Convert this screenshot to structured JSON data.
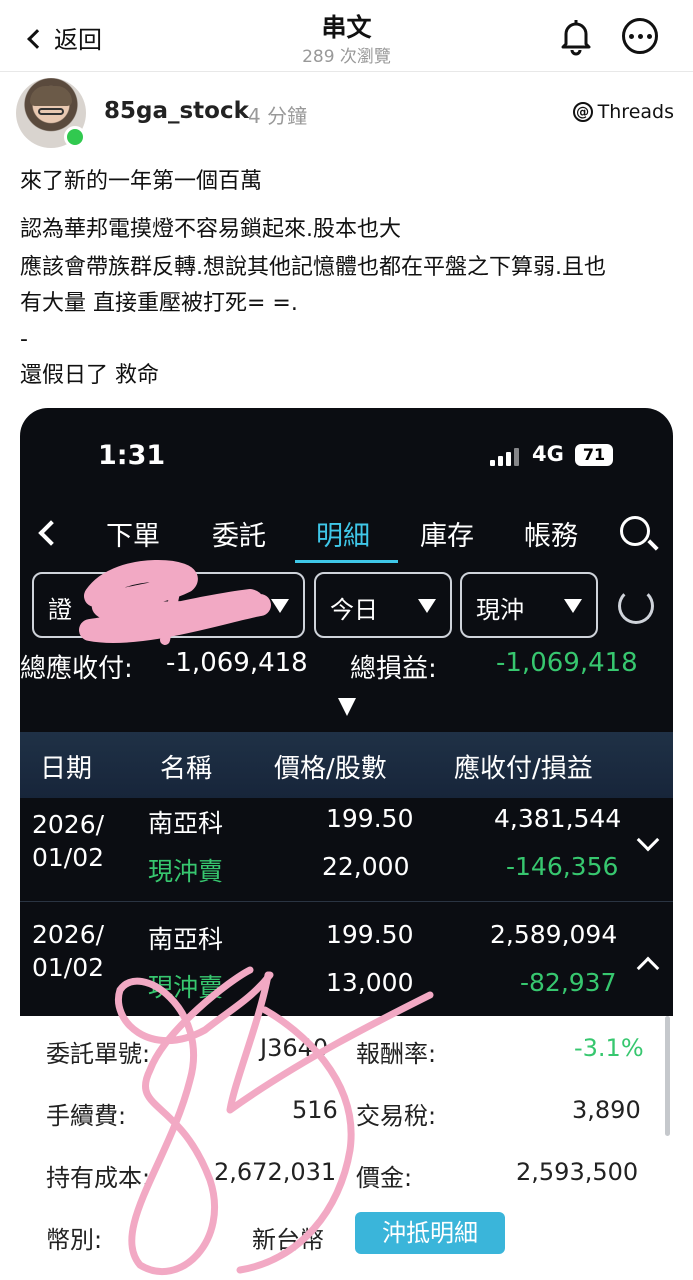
{
  "nav": {
    "back_label": "返回",
    "title": "串文",
    "views": "289 次瀏覽"
  },
  "post": {
    "username": "85ga_stock",
    "time": "4 分鐘",
    "platform": "Threads",
    "lines": [
      "來了新的一年第一個百萬",
      "認為華邦電摸燈不容易鎖起來.股本也大",
      "應該會帶族群反轉.想說其他記憶體也都在平盤之下算弱.且也",
      "有大量 直接重壓被打死= =.",
      "-",
      "還假日了 救命"
    ]
  },
  "screenshot": {
    "status": {
      "time": "1:31",
      "network": "4G",
      "battery": "71"
    },
    "tabs": [
      "下單",
      "委託",
      "明細",
      "庫存",
      "帳務"
    ],
    "active_tab": "明細",
    "filters": {
      "account": "證",
      "period": "今日",
      "type": "現沖"
    },
    "totals": {
      "receivable_label": "總應收付:",
      "receivable_value": "-1,069,418",
      "pnl_label": "總損益:",
      "pnl_value": "-1,069,418"
    },
    "table": {
      "headers": [
        "日期",
        "名稱",
        "價格/股數",
        "應收付/損益"
      ],
      "rows": [
        {
          "date_year": "2026/",
          "date_md": "01/02",
          "name": "南亞科",
          "type": "現沖賣",
          "price": "199.50",
          "shares": "22,000",
          "receivable": "4,381,544",
          "pnl": "-146,356",
          "expanded": false
        },
        {
          "date_year": "2026/",
          "date_md": "01/02",
          "name": "南亞科",
          "type": "現沖賣",
          "price": "199.50",
          "shares": "13,000",
          "receivable": "2,589,094",
          "pnl": "-82,937",
          "expanded": true
        }
      ]
    },
    "detail": {
      "order_no_label": "委託單號:",
      "order_no_value": "J3640",
      "return_label": "報酬率:",
      "return_value": "-3.1%",
      "fee_label": "手續費:",
      "fee_value": "516",
      "tax_label": "交易稅:",
      "tax_value": "3,890",
      "cost_label": "持有成本:",
      "cost_value": "2,672,031",
      "amount_label": "價金:",
      "amount_value": "2,593,500",
      "currency_label": "幣別:",
      "currency_value": "新台幣",
      "offset_button": "沖抵明細"
    }
  },
  "colors": {
    "accent": "#3fc7e8",
    "profit_green": "#37c76f",
    "scribble": "#f2a9c4"
  }
}
